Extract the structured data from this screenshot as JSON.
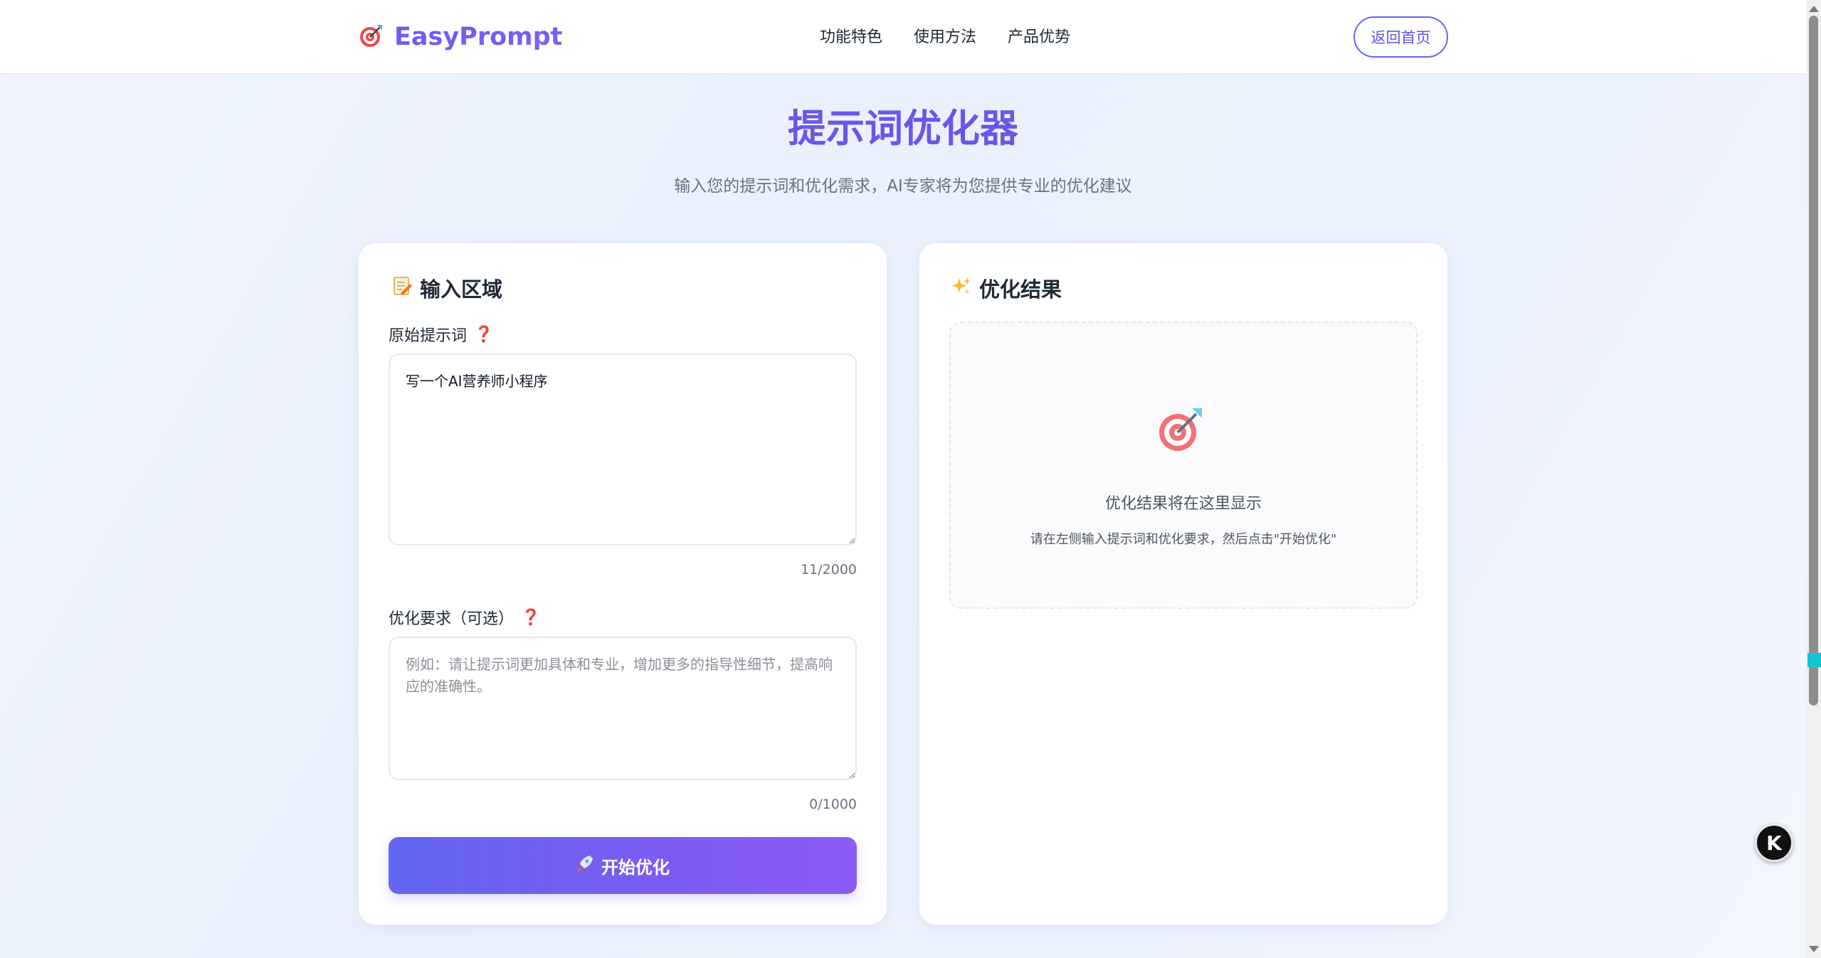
{
  "header": {
    "logo_text": "EasyPrompt",
    "logo_icon": "target-icon",
    "nav": [
      "功能特色",
      "使用方法",
      "产品优势"
    ],
    "home_button": "返回首页"
  },
  "hero": {
    "title": "提示词优化器",
    "subtitle": "输入您的提示词和优化需求，AI专家将为您提供专业的优化建议"
  },
  "input_card": {
    "title": "输入区域",
    "title_icon": "memo-icon",
    "prompt_label": "原始提示词",
    "prompt_value": "写一个AI营养师小程序",
    "prompt_counter": "11/2000",
    "requirement_label": "优化要求（可选）",
    "requirement_placeholder": "例如：请让提示词更加具体和专业，增加更多的指导性细节，提高响应的准确性。",
    "requirement_value": "",
    "requirement_counter": "0/1000",
    "start_button": "开始优化",
    "start_icon": "rocket-icon"
  },
  "result_card": {
    "title": "优化结果",
    "title_icon": "sparkles-icon",
    "empty_icon": "target-icon",
    "empty_main": "优化结果将在这里显示",
    "empty_sub": "请在左侧输入提示词和优化要求，然后点击\"开始优化\""
  },
  "floating": {
    "label": "K"
  },
  "colors": {
    "accent": "#6366f1",
    "title": "#6a57e8",
    "help": "#dc2626"
  }
}
